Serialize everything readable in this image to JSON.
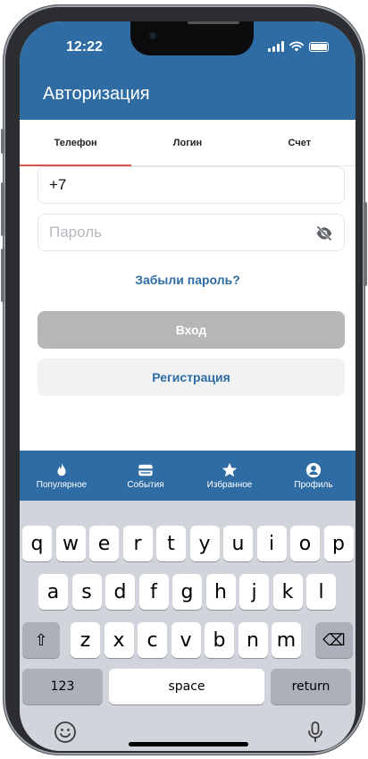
{
  "status": {
    "time": "12:22"
  },
  "header": {
    "title": "Авторизация"
  },
  "tabs": [
    {
      "label": "Телефон",
      "active": true
    },
    {
      "label": "Логин",
      "active": false
    },
    {
      "label": "Счет",
      "active": false
    }
  ],
  "form": {
    "phone_value": "+7",
    "password_placeholder": "Пароль",
    "forgot_label": "Забыли пароль?",
    "login_label": "Вход",
    "register_label": "Регистрация"
  },
  "bottom_nav": [
    {
      "label": "Популярное",
      "icon": "flame-icon"
    },
    {
      "label": "События",
      "icon": "card-icon"
    },
    {
      "label": "Избранное",
      "icon": "star-icon"
    },
    {
      "label": "Профиль",
      "icon": "profile-icon"
    }
  ],
  "keyboard": {
    "row1": [
      "q",
      "w",
      "e",
      "r",
      "t",
      "y",
      "u",
      "i",
      "o",
      "p"
    ],
    "row2": [
      "a",
      "s",
      "d",
      "f",
      "g",
      "h",
      "j",
      "k",
      "l"
    ],
    "row3": [
      "z",
      "x",
      "c",
      "v",
      "b",
      "n",
      "m"
    ],
    "shift": "⇧",
    "delete": "⌫",
    "numbers": "123",
    "space": "space",
    "return": "return"
  },
  "colors": {
    "primary": "#2f6ca4",
    "tab_indicator": "#d9534f",
    "disabled_button": "#b5b6b8"
  }
}
